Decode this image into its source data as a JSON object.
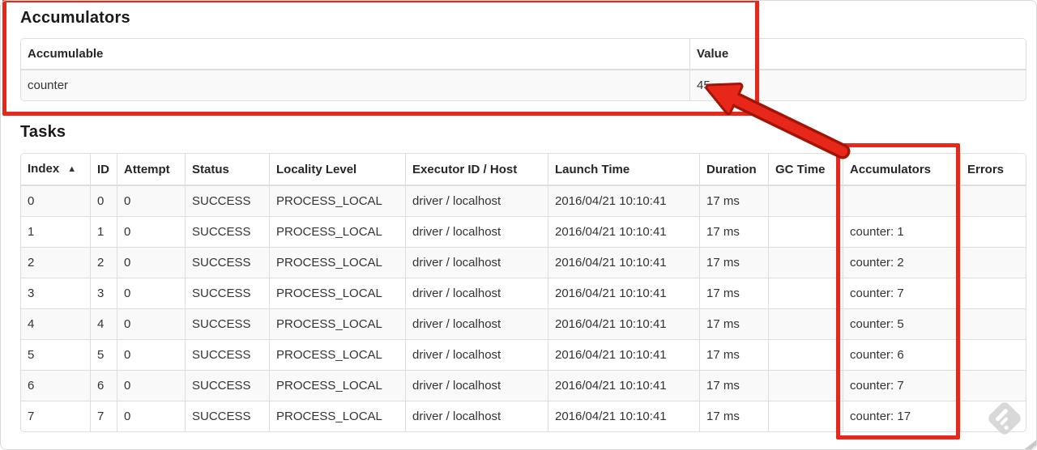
{
  "annotation_red": "#e8271b",
  "annotation_red_outline": "#a31405",
  "accumulators_section": {
    "title": "Accumulators",
    "table": {
      "headers": [
        "Accumulable",
        "Value"
      ],
      "rows": [
        [
          "counter",
          "45"
        ]
      ]
    }
  },
  "tasks_section": {
    "title": "Tasks",
    "table": {
      "headers": [
        "Index",
        "ID",
        "Attempt",
        "Status",
        "Locality Level",
        "Executor ID / Host",
        "Launch Time",
        "Duration",
        "GC Time",
        "Accumulators",
        "Errors"
      ],
      "sort_icon": "▲",
      "sorted_column": "Index",
      "rows": [
        [
          "0",
          "0",
          "0",
          "SUCCESS",
          "PROCESS_LOCAL",
          "driver / localhost",
          "2016/04/21 10:10:41",
          "17 ms",
          "",
          "",
          ""
        ],
        [
          "1",
          "1",
          "0",
          "SUCCESS",
          "PROCESS_LOCAL",
          "driver / localhost",
          "2016/04/21 10:10:41",
          "17 ms",
          "",
          "counter: 1",
          ""
        ],
        [
          "2",
          "2",
          "0",
          "SUCCESS",
          "PROCESS_LOCAL",
          "driver / localhost",
          "2016/04/21 10:10:41",
          "17 ms",
          "",
          "counter: 2",
          ""
        ],
        [
          "3",
          "3",
          "0",
          "SUCCESS",
          "PROCESS_LOCAL",
          "driver / localhost",
          "2016/04/21 10:10:41",
          "17 ms",
          "",
          "counter: 7",
          ""
        ],
        [
          "4",
          "4",
          "0",
          "SUCCESS",
          "PROCESS_LOCAL",
          "driver / localhost",
          "2016/04/21 10:10:41",
          "17 ms",
          "",
          "counter: 5",
          ""
        ],
        [
          "5",
          "5",
          "0",
          "SUCCESS",
          "PROCESS_LOCAL",
          "driver / localhost",
          "2016/04/21 10:10:41",
          "17 ms",
          "",
          "counter: 6",
          ""
        ],
        [
          "6",
          "6",
          "0",
          "SUCCESS",
          "PROCESS_LOCAL",
          "driver / localhost",
          "2016/04/21 10:10:41",
          "17 ms",
          "",
          "counter: 7",
          ""
        ],
        [
          "7",
          "7",
          "0",
          "SUCCESS",
          "PROCESS_LOCAL",
          "driver / localhost",
          "2016/04/21 10:10:41",
          "17 ms",
          "",
          "counter: 17",
          ""
        ]
      ]
    }
  }
}
